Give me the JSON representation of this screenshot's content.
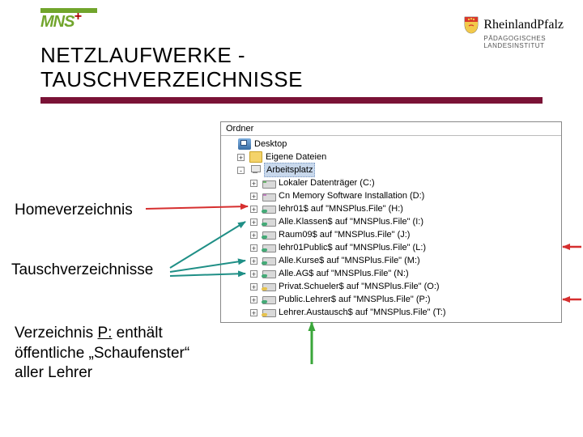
{
  "logos": {
    "mns_text": "MNS",
    "mns_plus": "+",
    "rp_text": "RheinlandPfalz",
    "rp_sub1": "PÄDAGOGISCHES",
    "rp_sub2": "LANDESINSTITUT"
  },
  "title": {
    "line1": "NETZLAUFWERKE -",
    "line2": "TAUSCHVERZEICHNISSE"
  },
  "annotations": {
    "home": "Homeverzeichnis",
    "tausch": "Tauschverzeichnisse",
    "verz_p_1": "Verzeichnis ",
    "verz_p_u": "P:",
    "verz_p_2": " enthält öffentliche „Schaufenster“ aller Lehrer"
  },
  "tree": {
    "header": "Ordner",
    "nodes": [
      {
        "indent": 0,
        "exp": "",
        "icon": "desktop",
        "label": "Desktop"
      },
      {
        "indent": 1,
        "exp": "+",
        "icon": "folder",
        "label": "Eigene Dateien"
      },
      {
        "indent": 1,
        "exp": "-",
        "icon": "arbeitsplatz",
        "label": "Arbeitsplatz",
        "selected": true
      },
      {
        "indent": 2,
        "exp": "+",
        "icon": "disk",
        "label": "Lokaler Datenträger (C:)"
      },
      {
        "indent": 2,
        "exp": "+",
        "icon": "cd",
        "label": "Cn Memory Software Installation (D:)"
      },
      {
        "indent": 2,
        "exp": "+",
        "icon": "net",
        "label": "lehr01$ auf \"MNSPlus.File\" (H:)"
      },
      {
        "indent": 2,
        "exp": "+",
        "icon": "net",
        "label": "Alle.Klassen$ auf \"MNSPlus.File\" (I:)"
      },
      {
        "indent": 2,
        "exp": "+",
        "icon": "net",
        "label": "Raum09$ auf \"MNSPlus.File\" (J:)"
      },
      {
        "indent": 2,
        "exp": "+",
        "icon": "net",
        "label": "lehr01Public$ auf \"MNSPlus.File\" (L:)"
      },
      {
        "indent": 2,
        "exp": "+",
        "icon": "net",
        "label": "Alle.Kurse$ auf \"MNSPlus.File\" (M:)"
      },
      {
        "indent": 2,
        "exp": "+",
        "icon": "net",
        "label": "Alle.AG$ auf \"MNSPlus.File\" (N:)"
      },
      {
        "indent": 2,
        "exp": "+",
        "icon": "netY",
        "label": "Privat.Schueler$ auf \"MNSPlus.File\" (O:)"
      },
      {
        "indent": 2,
        "exp": "+",
        "icon": "net",
        "label": "Public.Lehrer$ auf \"MNSPlus.File\" (P:)"
      },
      {
        "indent": 2,
        "exp": "+",
        "icon": "netY",
        "label": "Lehrer.Austausch$ auf \"MNSPlus.File\" (T:)"
      }
    ]
  }
}
